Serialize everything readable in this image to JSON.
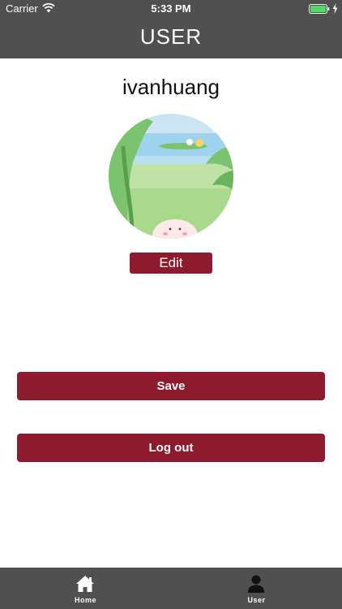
{
  "status_bar": {
    "carrier": "Carrier",
    "time": "5:33 PM",
    "battery_color": "#4cd964"
  },
  "header": {
    "title": "USER",
    "background": "#505050"
  },
  "profile": {
    "username": "ivanhuang",
    "avatar_icon": "avatar-illustration"
  },
  "buttons": {
    "edit_label": "Edit",
    "save_label": "Save",
    "logout_label": "Log out",
    "accent_color": "#8e1a2e"
  },
  "tab_bar": {
    "tabs": [
      {
        "label": "Home",
        "icon": "home-icon"
      },
      {
        "label": "User",
        "icon": "user-icon"
      }
    ]
  }
}
